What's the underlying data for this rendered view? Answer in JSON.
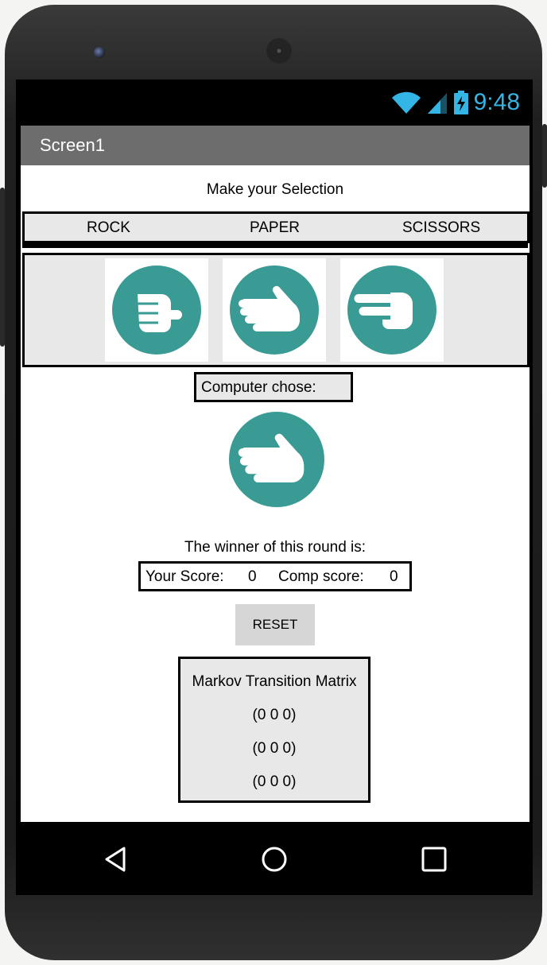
{
  "status": {
    "time": "9:48"
  },
  "appbar": {
    "title": "Screen1"
  },
  "selection": {
    "heading": "Make your Selection",
    "labels": [
      "ROCK",
      "PAPER",
      "SCISSORS"
    ],
    "images": [
      "rock-hand-icon",
      "paper-hand-icon",
      "scissors-hand-icon"
    ]
  },
  "computer": {
    "label": "Computer chose:",
    "choice_icon": "paper-hand-icon"
  },
  "winner": {
    "label": "The winner of this round is:"
  },
  "score": {
    "your_label": "Your Score:",
    "your_value": "0",
    "comp_label": "Comp score:",
    "comp_value": "0"
  },
  "reset": {
    "label": "RESET"
  },
  "markov": {
    "title": "Markov Transition Matrix",
    "rows": [
      "(0 0 0)",
      "(0 0 0)",
      "(0 0 0)"
    ]
  },
  "navbar": {
    "icons": [
      "back-icon",
      "home-icon",
      "recents-icon"
    ]
  },
  "colors": {
    "accent": "#3a9a94",
    "status_blue": "#33b5e5",
    "appbar": "#6d6d6d"
  }
}
